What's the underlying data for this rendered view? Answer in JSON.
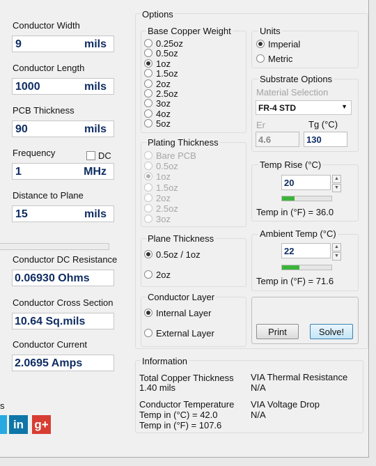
{
  "left": {
    "conductor_width": {
      "label": "Conductor Width",
      "value": "9",
      "unit": "mils"
    },
    "conductor_length": {
      "label": "Conductor Length",
      "value": "1000",
      "unit": "mils"
    },
    "pcb_thickness": {
      "label": "PCB Thickness",
      "value": "90",
      "unit": "mils"
    },
    "frequency": {
      "label": "Frequency",
      "dc_label": "DC",
      "value": "1",
      "unit": "MHz"
    },
    "distance_to_plane": {
      "label": "Distance to Plane",
      "value": "15",
      "unit": "mils"
    },
    "dc_resistance": {
      "label": "Conductor DC Resistance",
      "value": "0.06930 Ohms"
    },
    "cross_section": {
      "label": "Conductor Cross Section",
      "value": "10.64 Sq.mils"
    },
    "current": {
      "label": "Conductor Current",
      "value": "2.0695 Amps"
    },
    "social_caption": "s",
    "social": {
      "linkedin": "in",
      "googleplus": "g+"
    }
  },
  "options": {
    "title": "Options",
    "base_copper": {
      "title": "Base Copper Weight",
      "items": [
        "0.25oz",
        "0.5oz",
        "1oz",
        "1.5oz",
        "2oz",
        "2.5oz",
        "3oz",
        "4oz",
        "5oz"
      ],
      "selected": "1oz"
    },
    "plating": {
      "title": "Plating Thickness",
      "items": [
        "Bare PCB",
        "0.5oz",
        "1oz",
        "1.5oz",
        "2oz",
        "2.5oz",
        "3oz"
      ],
      "selected": "1oz"
    },
    "plane_thickness": {
      "title": "Plane Thickness",
      "items": [
        "0.5oz / 1oz",
        "2oz"
      ],
      "selected": "0.5oz / 1oz"
    },
    "conductor_layer": {
      "title": "Conductor Layer",
      "items": [
        "Internal Layer",
        "External Layer"
      ],
      "selected": "Internal Layer"
    },
    "units": {
      "title": "Units",
      "items": [
        "Imperial",
        "Metric"
      ],
      "selected": "Imperial"
    },
    "substrate": {
      "title": "Substrate Options",
      "material_label": "Material Selection",
      "material": "FR-4 STD",
      "er_label": "Er",
      "er_value": "4.6",
      "tg_label": "Tg (°C)",
      "tg_value": "130"
    },
    "temp_rise": {
      "title": "Temp Rise (°C)",
      "value": "20",
      "progress": 0.25,
      "readout": "Temp in (°F) = 36.0"
    },
    "ambient_temp": {
      "title": "Ambient Temp (°C)",
      "value": "22",
      "progress": 0.35,
      "readout": "Temp in (°F) = 71.6"
    },
    "buttons": {
      "print": "Print",
      "solve": "Solve!"
    }
  },
  "information": {
    "title": "Information",
    "total_copper_label": "Total Copper Thickness",
    "total_copper_value": "1.40 mils",
    "via_thermal_label": "VIA Thermal Resistance",
    "via_thermal_value": "N/A",
    "conductor_temp_label": "Conductor Temperature",
    "conductor_temp_c": "Temp in (°C) = 42.0",
    "conductor_temp_f": "Temp in (°F) = 107.6",
    "via_drop_label": "VIA Voltage Drop",
    "via_drop_value": "N/A"
  },
  "colors": {
    "value_text": "#0f2d63",
    "progress": "#3cb43c",
    "linkedin": "#0e76a8",
    "googleplus": "#d73d32",
    "twitter": "#29a9e1"
  }
}
